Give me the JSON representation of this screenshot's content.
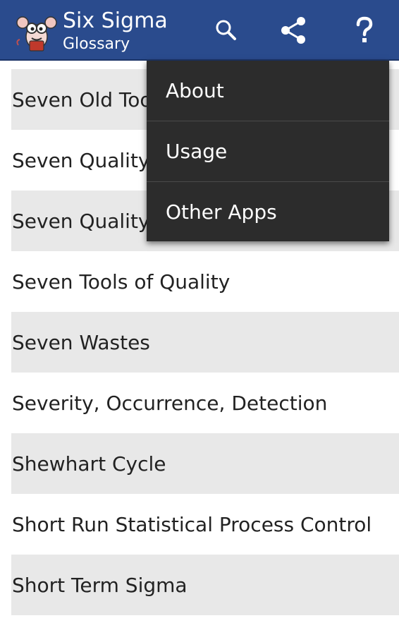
{
  "app": {
    "title": "Six Sigma",
    "subtitle": "Glossary"
  },
  "actions": [
    {
      "icon": "search-icon"
    },
    {
      "icon": "share-icon"
    },
    {
      "icon": "help-icon"
    }
  ],
  "overflow_menu": {
    "items": [
      "About",
      "Usage",
      "Other Apps"
    ]
  },
  "list": {
    "items": [
      "Seven Old Tools",
      "Seven Quality Tools",
      "Seven Quality Tools",
      "Seven Tools of Quality",
      "Seven Wastes",
      "Severity, Occurrence, Detection",
      "Shewhart Cycle",
      "Short Run Statistical Process Control",
      "Short Term Sigma"
    ]
  },
  "colors": {
    "appbar": "#2a4b8d",
    "menu": "#2c2c2c",
    "row_alt": "#e8e8e8"
  }
}
